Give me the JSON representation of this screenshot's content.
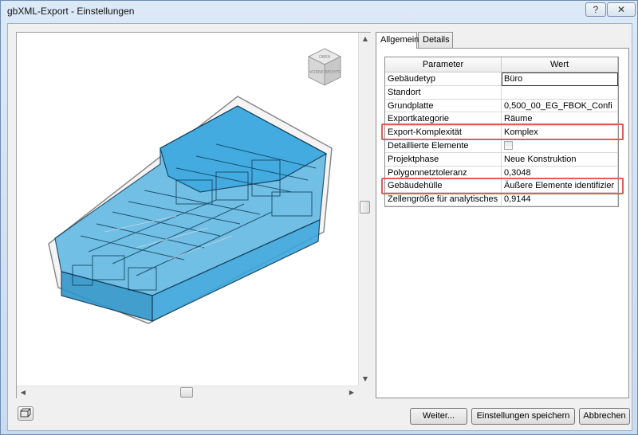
{
  "window": {
    "title": "gbXML-Export - Einstellungen",
    "help_label": "?",
    "close_label": "✕"
  },
  "tabs": [
    {
      "label": "Allgemein",
      "active": true
    },
    {
      "label": "Details",
      "active": false
    }
  ],
  "grid": {
    "headers": {
      "parameter": "Parameter",
      "wert": "Wert"
    },
    "rows": [
      {
        "param": "Gebäudetyp",
        "value": "Büro"
      },
      {
        "param": "Standort",
        "value": ""
      },
      {
        "param": "Grundplatte",
        "value": "0,500_00_EG_FBOK_Confi"
      },
      {
        "param": "Exportkategorie",
        "value": "Räume"
      },
      {
        "param": "Export-Komplexität",
        "value": "Komplex"
      },
      {
        "param": "Detaillierte Elemente",
        "value": ""
      },
      {
        "param": "Projektphase",
        "value": "Neue Konstruktion"
      },
      {
        "param": "Polygonnetztoleranz",
        "value": "0,3048"
      },
      {
        "param": "Gebäudehülle",
        "value": "Äußere Elemente identifizier"
      },
      {
        "param": "Zellengröße für analytisches",
        "value": "0,9144"
      }
    ]
  },
  "viewcube": {
    "top": "OBEN",
    "front": "VORNE",
    "right": "RECHTS"
  },
  "buttons": {
    "weiter": "Weiter...",
    "save": "Einstellungen speichern",
    "cancel": "Abbrechen"
  },
  "colors": {
    "model_fill": "#3aa6dc",
    "model_edge": "#0d3a57",
    "highlight": "#e55a5a"
  },
  "icons": {
    "view_toggle": "3d-view-icon",
    "help": "help-icon",
    "close": "close-icon"
  }
}
